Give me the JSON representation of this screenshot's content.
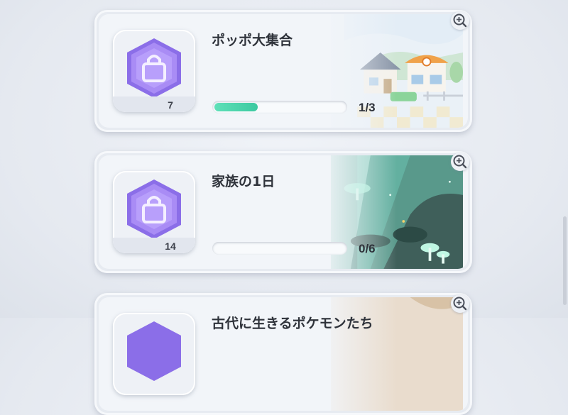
{
  "missions": [
    {
      "title": "ポッポ大集合",
      "count": "7",
      "progress_text": "1/3",
      "progress": 0.3333,
      "scene": "town"
    },
    {
      "title": "家族の1日",
      "count": "14",
      "progress_text": "0/6",
      "progress": 0,
      "scene": "forest"
    },
    {
      "title": "古代に生きるポケモンたち",
      "count": "",
      "progress_text": "",
      "progress": 0,
      "scene": "cave"
    }
  ],
  "colors": {
    "accent": "#3cc9a0",
    "badge_purple": "#9b7cf0",
    "card_bg": "#f2f5f9"
  },
  "icons": {
    "badge": "shopping-bag-hexagon-icon",
    "zoom": "zoom-in-icon"
  }
}
